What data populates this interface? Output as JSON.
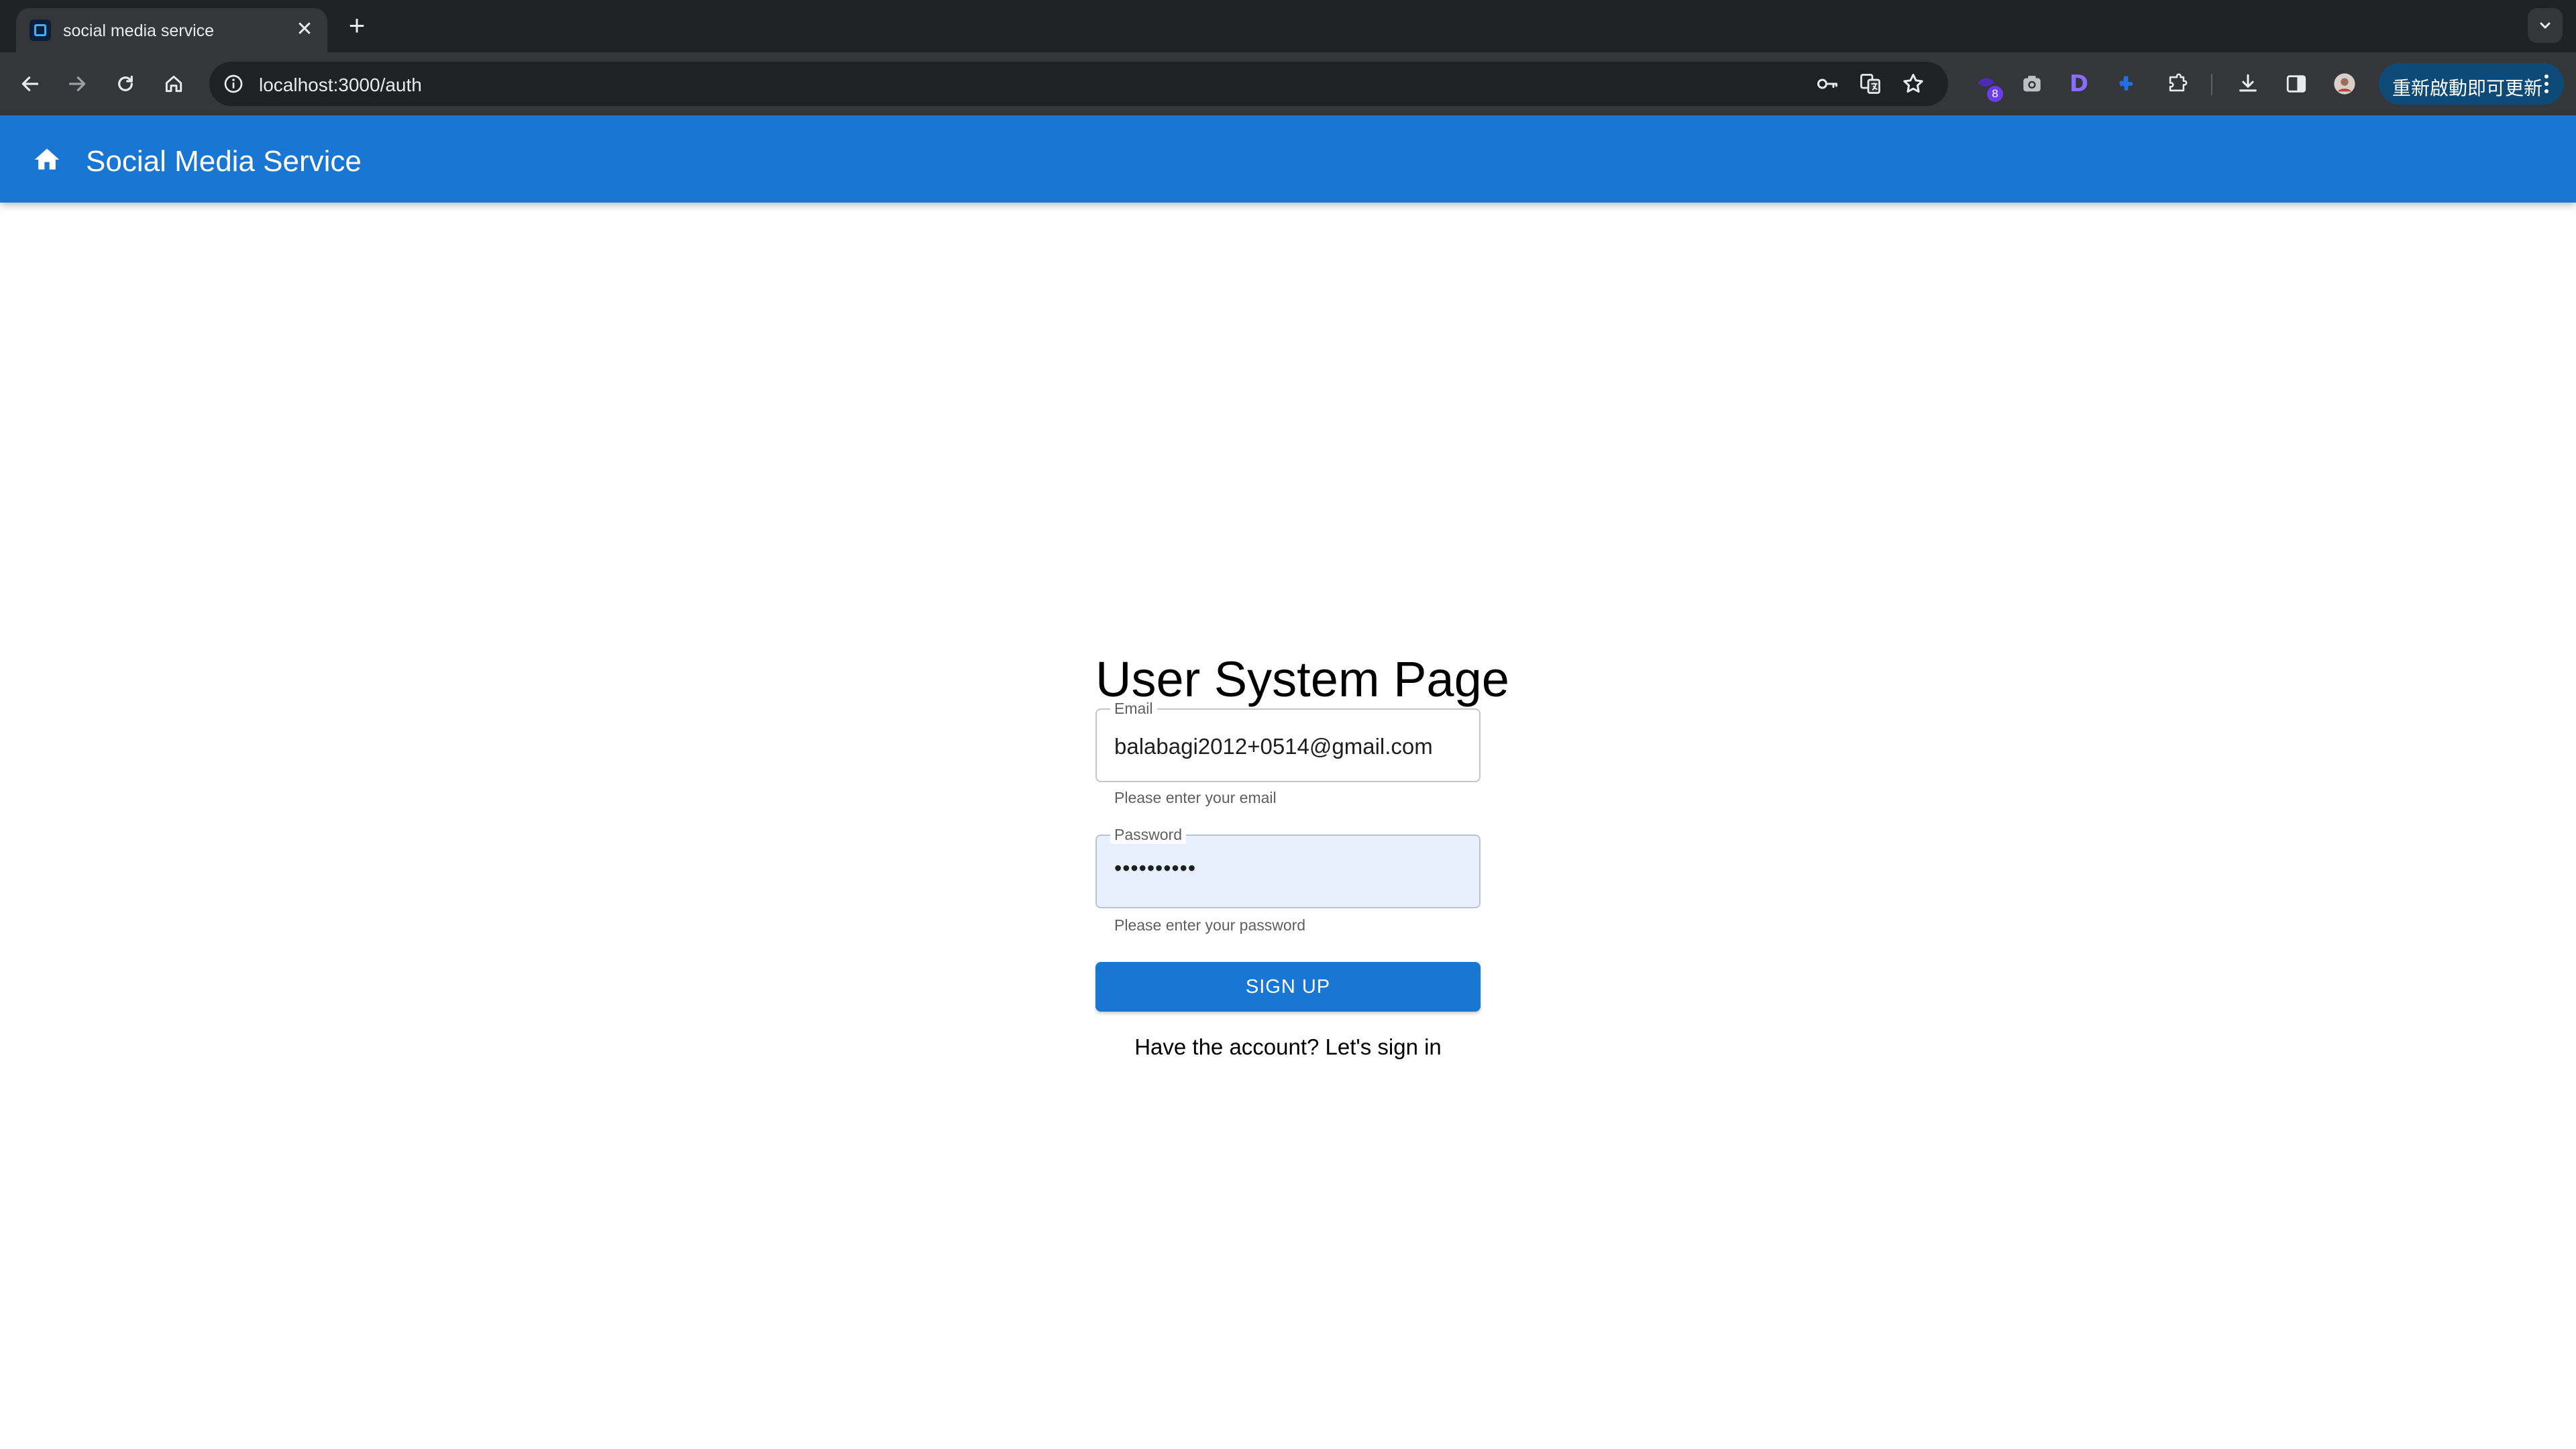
{
  "browser": {
    "tab": {
      "title": "social media service",
      "close_symbol": "✕"
    },
    "new_tab_symbol": "+",
    "omnibox": {
      "url": "localhost:3000/auth"
    },
    "extensions": {
      "badge_count": "8",
      "d_letter": "D"
    },
    "update_button": {
      "label": "重新啟動即可更新"
    },
    "colors": {
      "tabstrip_bg": "#202124",
      "toolbar_bg": "#35363a",
      "omnibox_bg": "#202124",
      "update_bg": "#0d4a78"
    }
  },
  "appbar": {
    "title": "Social Media Service",
    "color": "#1976d2"
  },
  "form": {
    "heading": "User System Page",
    "email": {
      "label": "Email",
      "value": "balabagi2012+0514@gmail.com",
      "helper": "Please enter your email"
    },
    "password": {
      "label": "Password",
      "masked_value": "••••••••••",
      "helper": "Please enter your password"
    },
    "submit_label": "SIGN UP",
    "switch_link": "Have the account? Let's sign in"
  }
}
